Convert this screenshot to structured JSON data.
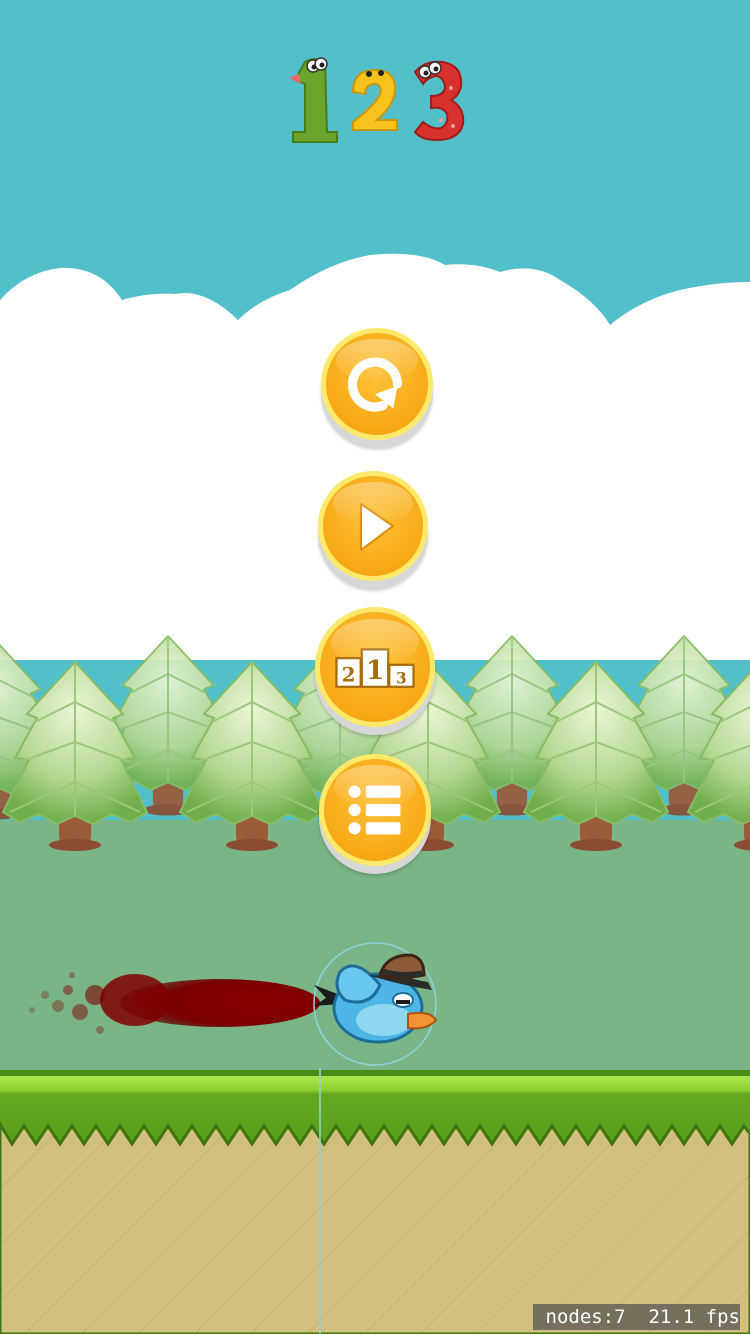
{
  "game": {
    "score": "123",
    "digit_colors": [
      "#6aa42a",
      "#f6c21b",
      "#d6312c"
    ]
  },
  "menu": {
    "buttons": [
      {
        "name": "restart-button",
        "icon": "restart-icon"
      },
      {
        "name": "play-button",
        "icon": "play-icon"
      },
      {
        "name": "leaderboard-button",
        "icon": "podium-icon",
        "podium_labels": [
          "2",
          "1",
          "3"
        ]
      },
      {
        "name": "menu-list-button",
        "icon": "list-icon"
      }
    ]
  },
  "debug": {
    "nodes_label": "nodes:7",
    "fps_label": "21.1 fps"
  },
  "colors": {
    "sky": "#52c0cb",
    "cloud": "#ffffff",
    "meadow": "#7ab587",
    "grass": "#5ea41e",
    "grass_light": "#a7e34a",
    "dirt": "#d4c07e",
    "button_orange": "#f7a915",
    "button_rim": "#ffe96a",
    "bird_blue": "#4db6e6",
    "blood": "#8b0000"
  }
}
